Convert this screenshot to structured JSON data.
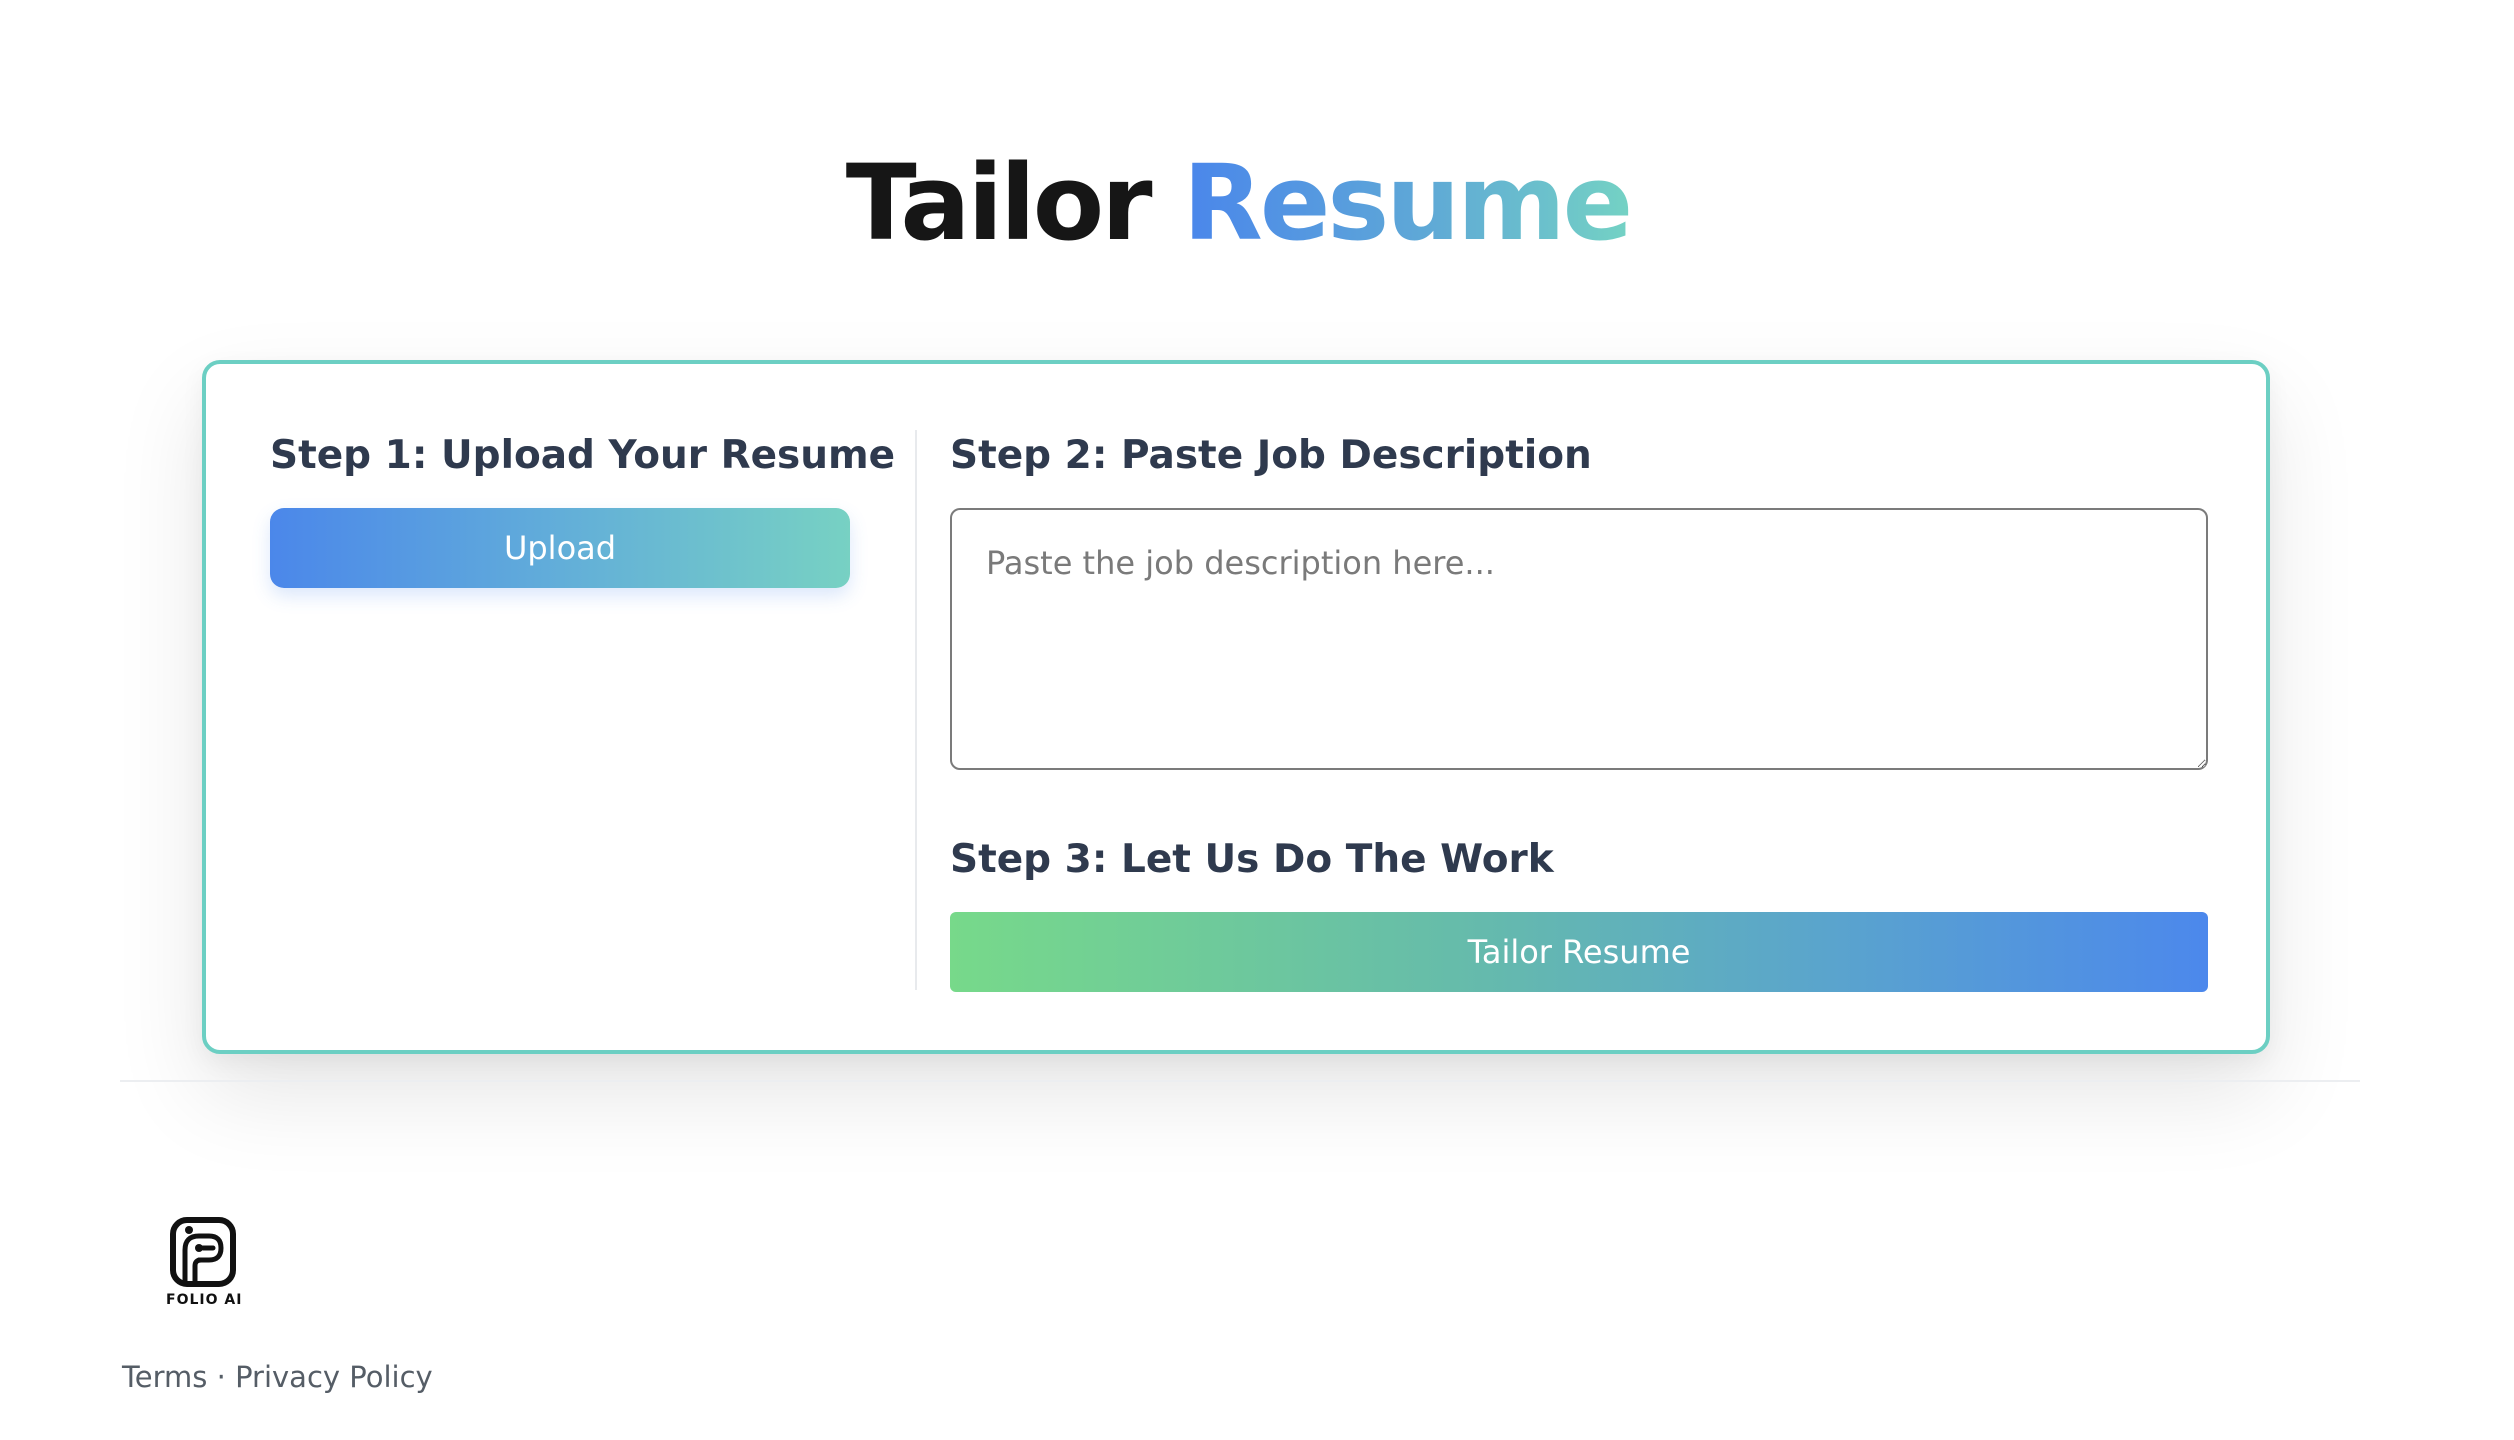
{
  "header": {
    "title_part1": "Tailor",
    "title_part2": "Resume"
  },
  "steps": {
    "step1": {
      "heading": "Step 1: Upload Your Resume",
      "button_label": "Upload"
    },
    "step2": {
      "heading": "Step 2: Paste Job Description",
      "placeholder": "Paste the job description here...",
      "value": ""
    },
    "step3": {
      "heading": "Step 3: Let Us Do The Work",
      "button_label": "Tailor Resume"
    }
  },
  "footer": {
    "logo_text": "FOLIO AI",
    "logo_icon": "folio-ai-logo-icon",
    "terms_label": "Terms",
    "separator": "·",
    "privacy_label": "Privacy Policy"
  },
  "colors": {
    "accent_blue": "#4a86eb",
    "accent_teal": "#74d2c4",
    "accent_green": "#77d98a",
    "card_border": "#6ccfc3",
    "heading_text": "#2f3a4e"
  }
}
